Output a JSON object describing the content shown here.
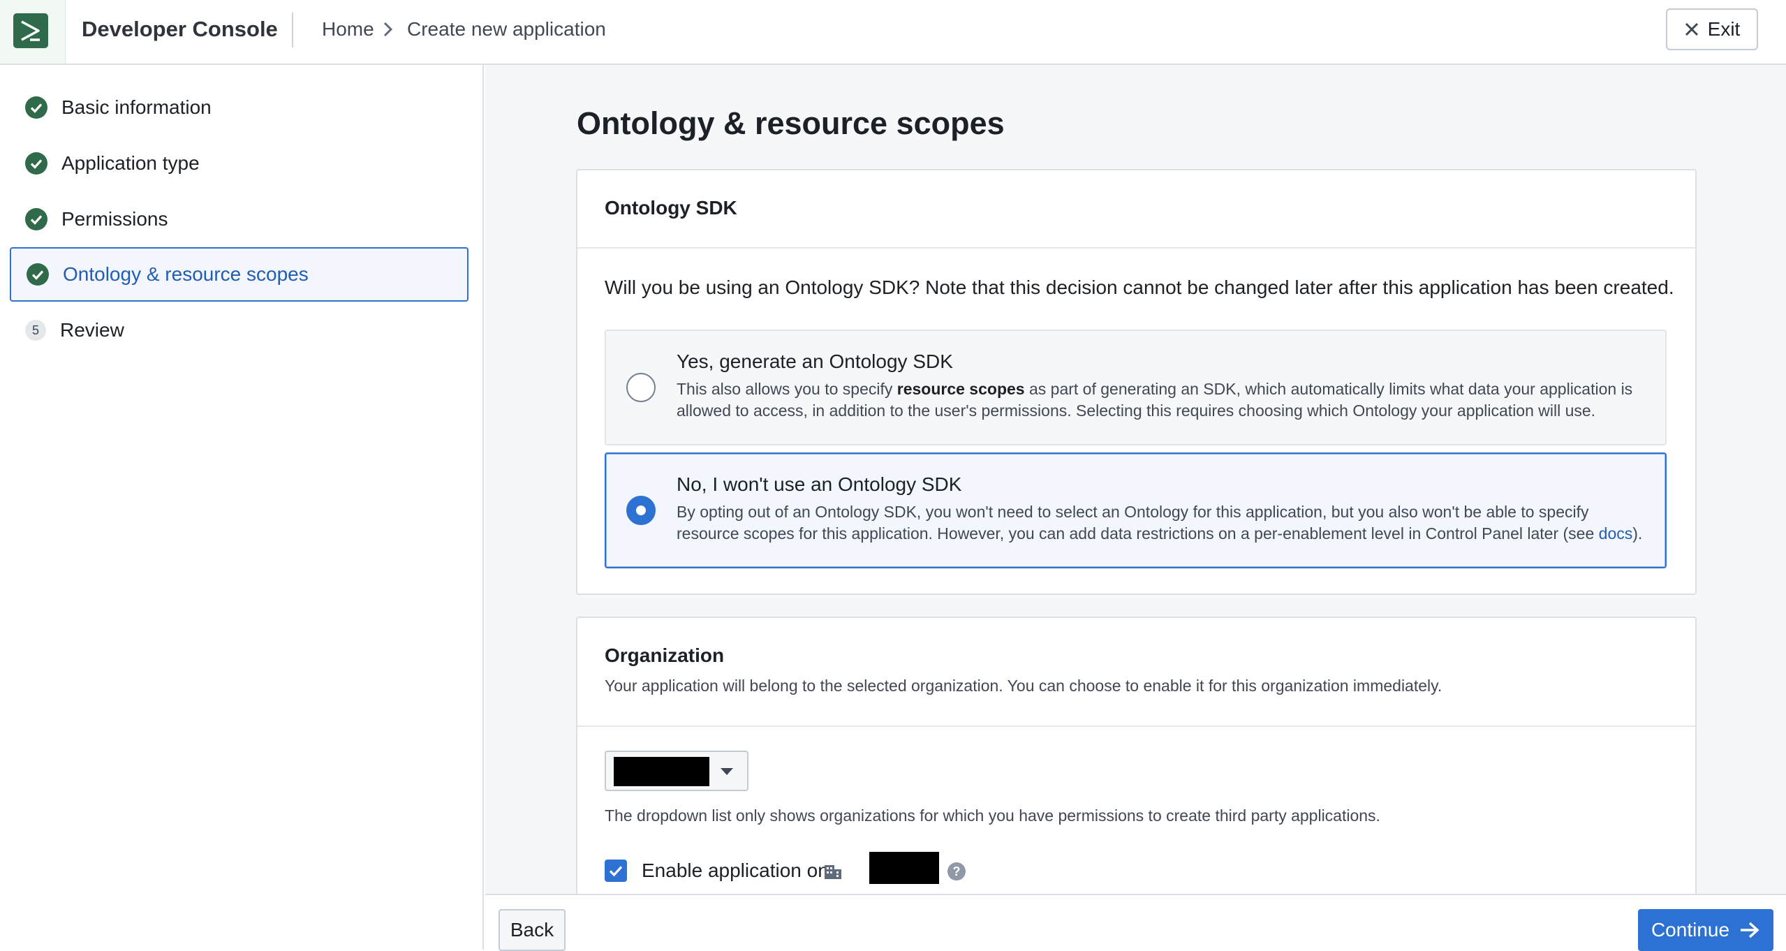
{
  "header": {
    "app_title": "Developer Console",
    "breadcrumb": {
      "home": "Home",
      "current": "Create new application"
    },
    "exit_label": "Exit"
  },
  "sidebar": {
    "steps": [
      {
        "label": "Basic information",
        "status": "complete"
      },
      {
        "label": "Application type",
        "status": "complete"
      },
      {
        "label": "Permissions",
        "status": "complete"
      },
      {
        "label": "Ontology & resource scopes",
        "status": "current"
      },
      {
        "label": "Review",
        "status": "pending",
        "number": "5"
      }
    ]
  },
  "main": {
    "page_title": "Ontology & resource scopes",
    "ontology_card": {
      "title": "Ontology SDK",
      "question": "Will you be using an Ontology SDK? Note that this decision cannot be changed later after this application has been created.",
      "options": [
        {
          "title": "Yes, generate an Ontology SDK",
          "desc_pre": "This also allows you to specify ",
          "desc_bold": "resource scopes",
          "desc_post": " as part of generating an SDK, which automatically limits what data your application is allowed to access, in addition to the user's permissions. Selecting this requires choosing which Ontology your application will use.",
          "selected": false
        },
        {
          "title": "No, I won't use an Ontology SDK",
          "desc_pre": "By opting out of an Ontology SDK, you won't need to select an Ontology for this application, but you also won't be able to specify resource scopes for this application. However, you can add data restrictions on a per-enablement level in Control Panel later (see ",
          "desc_link": "docs",
          "desc_post": ").",
          "selected": true
        }
      ]
    },
    "org_card": {
      "title": "Organization",
      "subtitle": "Your application will belong to the selected organization. You can choose to enable it for this organization immediately.",
      "helper": "The dropdown list only shows organizations for which you have permissions to create third party applications.",
      "enable_label": "Enable application on",
      "enable_checked": true
    }
  },
  "footer": {
    "back_label": "Back",
    "continue_label": "Continue"
  },
  "colors": {
    "primary": "#2d72d2",
    "success": "#2f6a4a",
    "text": "#1c2127"
  }
}
